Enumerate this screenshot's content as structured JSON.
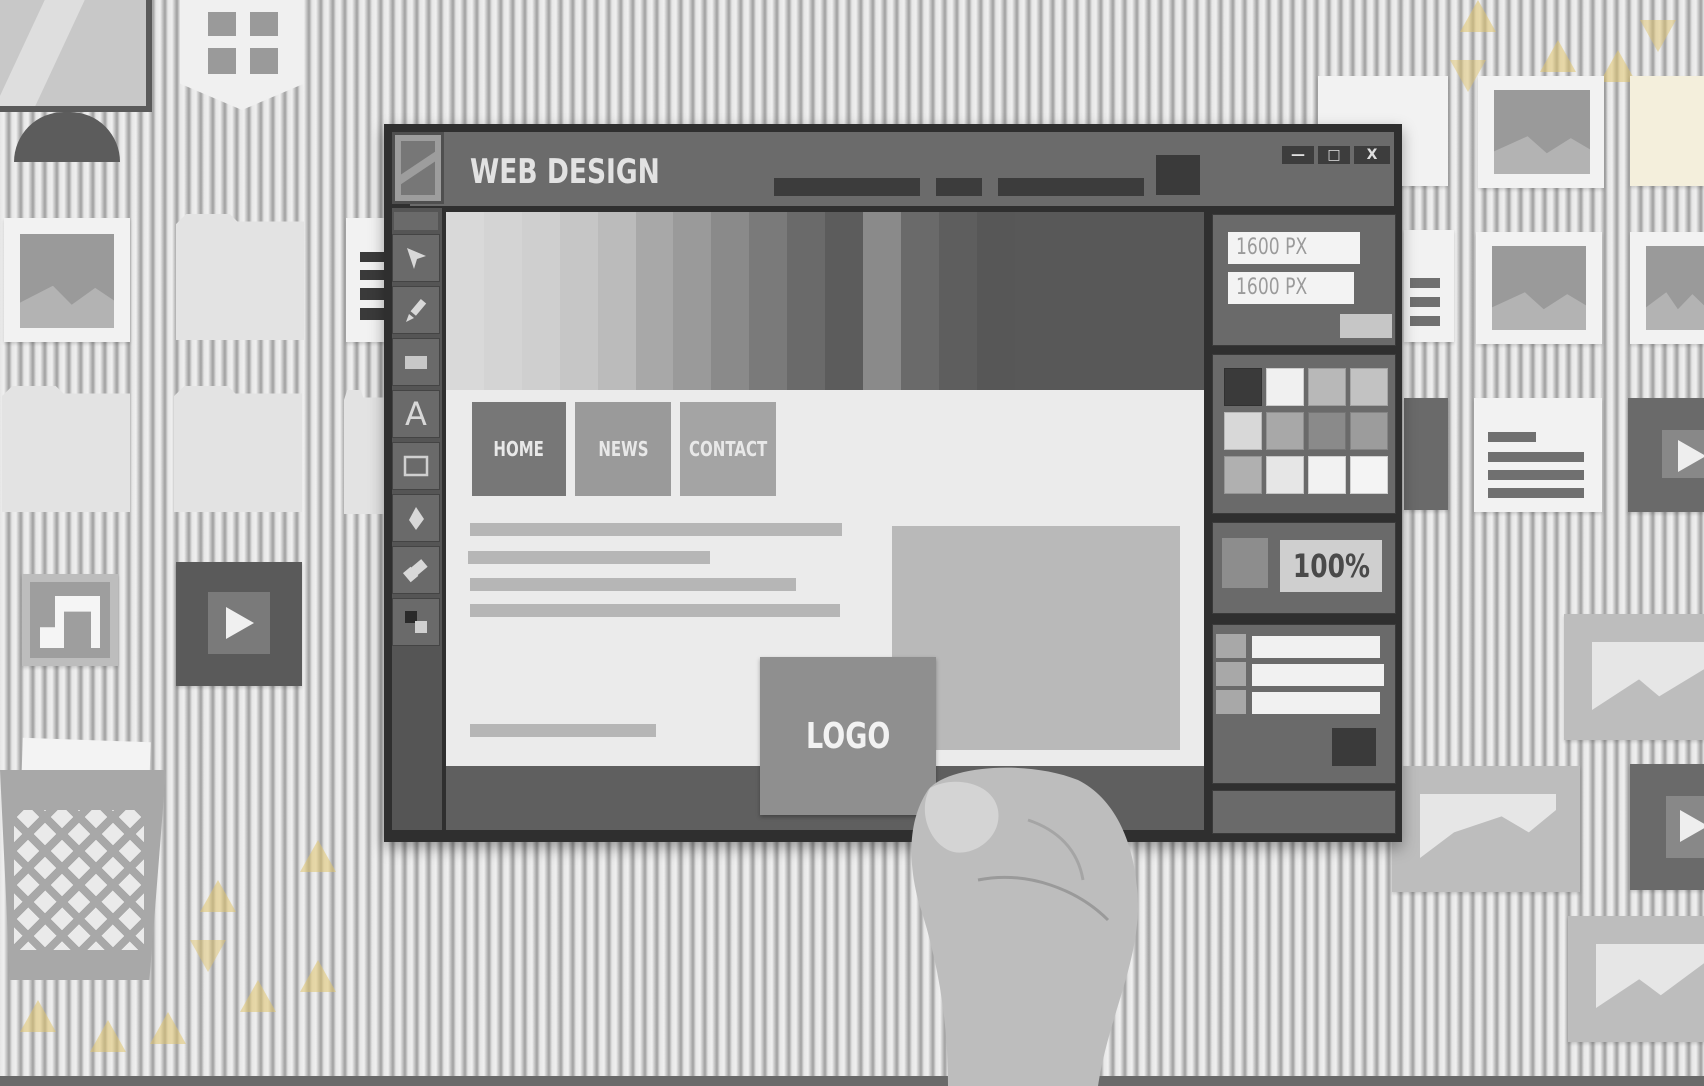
{
  "window": {
    "title": "WEB DESIGN",
    "controls": {
      "minimize": "—",
      "maximize": "□",
      "close": "X"
    }
  },
  "toolbar": {
    "tools": [
      {
        "name": "select",
        "icon": "arrow-cursor-icon"
      },
      {
        "name": "brush",
        "icon": "brush-icon"
      },
      {
        "name": "rectangle-fill",
        "icon": "filled-rectangle-icon"
      },
      {
        "name": "text",
        "icon": "text-a-icon",
        "glyph": "A"
      },
      {
        "name": "rectangle-outline",
        "icon": "outline-rectangle-icon"
      },
      {
        "name": "pen",
        "icon": "pen-diamond-icon"
      },
      {
        "name": "eraser",
        "icon": "eraser-icon"
      },
      {
        "name": "colors",
        "icon": "color-swap-icon"
      }
    ]
  },
  "canvas": {
    "nav": [
      {
        "label": "HOME",
        "color": "#777777"
      },
      {
        "label": "NEWS",
        "color": "#9a9a9a"
      },
      {
        "label": "CONTACT",
        "color": "#a4a4a4"
      }
    ],
    "logo_label": "LOGO"
  },
  "properties": {
    "width": "1600 PX",
    "height": "1600 PX"
  },
  "palette": {
    "swatches": [
      "#3a3a3a",
      "#f0f0f0",
      "#b8b8b8",
      "#c2c2c2",
      "#d8d8d8",
      "#a8a8a8",
      "#8a8a8a",
      "#9c9c9c",
      "#b0b0b0",
      "#e6e6e6",
      "#f2f2f2",
      "#f4f4f4"
    ]
  },
  "zoom": {
    "value": "100%"
  },
  "layers": {
    "count": 3
  }
}
